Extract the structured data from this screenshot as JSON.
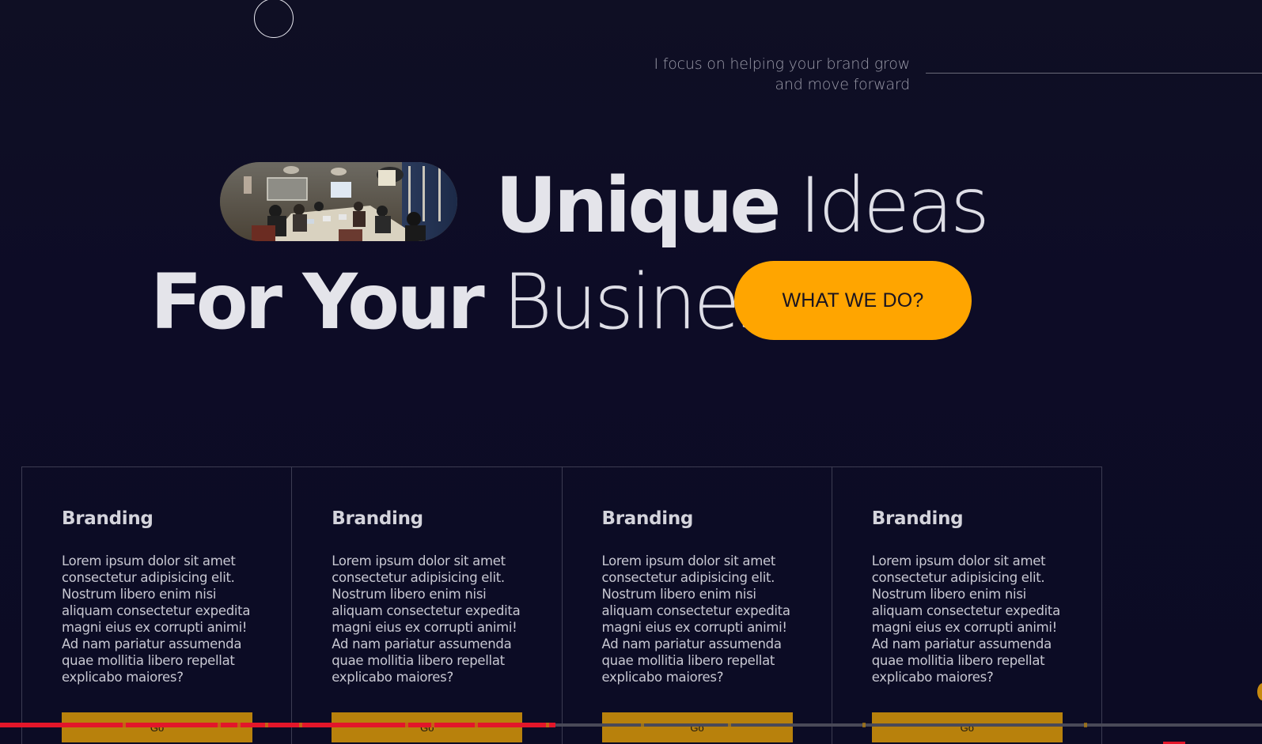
{
  "tagline": {
    "line1": "I focus on helping your brand grow",
    "line2": "and move forward"
  },
  "hero": {
    "line1_bold": "Unique",
    "line1_thin": "Ideas",
    "line2_bold": "For Your",
    "line2_thin": "Business.",
    "cta_label": "WHAT WE DO?"
  },
  "services": [
    {
      "title": "Branding",
      "body": "Lorem ipsum dolor sit amet consectetur adipisicing elit. Nostrum libero enim nisi aliquam consectetur expedita magni eius ex corrupti animi! Ad nam pariatur assumenda quae mollitia libero repellat explicabo maiores?",
      "button": "Go"
    },
    {
      "title": "Branding",
      "body": "Lorem ipsum dolor sit amet consectetur adipisicing elit. Nostrum libero enim nisi aliquam consectetur expedita magni eius ex corrupti animi! Ad nam pariatur assumenda quae mollitia libero repellat explicabo maiores?",
      "button": "Go"
    },
    {
      "title": "Branding",
      "body": "Lorem ipsum dolor sit amet consectetur adipisicing elit. Nostrum libero enim nisi aliquam consectetur expedita magni eius ex corrupti animi! Ad nam pariatur assumenda quae mollitia libero repellat explicabo maiores?",
      "button": "Go"
    },
    {
      "title": "Branding",
      "body": "Lorem ipsum dolor sit amet consectetur adipisicing elit. Nostrum libero enim nisi aliquam consectetur expedita magni eius ex corrupti animi! Ad nam pariatur assumenda quae mollitia libero repellat explicabo maiores?",
      "button": "Go"
    }
  ],
  "progress": {
    "fraction": 0.44
  },
  "colors": {
    "accent": "#ffa500",
    "button_muted": "#b8810c",
    "progress_fill": "#e3162a",
    "background": "#0c0b22"
  },
  "icons": {
    "cursor": "cursor-ring-icon",
    "hero_photo": "meeting-room-photo"
  }
}
